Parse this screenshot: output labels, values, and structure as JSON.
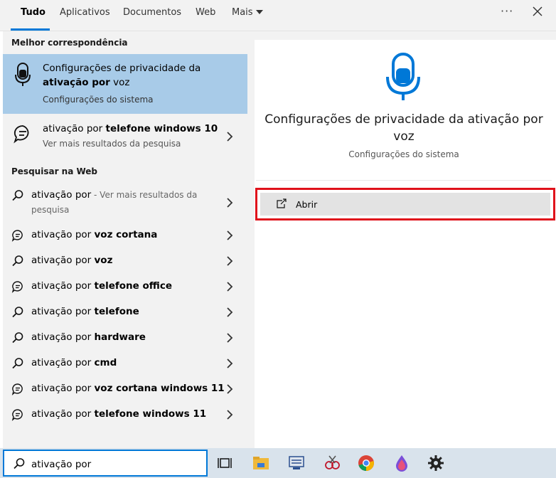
{
  "tabs": [
    {
      "label": "Tudo",
      "active": true
    },
    {
      "label": "Aplicativos"
    },
    {
      "label": "Documentos"
    },
    {
      "label": "Web"
    },
    {
      "label": "Mais"
    }
  ],
  "more_options_icon": "ellipsis-icon",
  "close_icon": "close-icon",
  "left": {
    "best_match_header": "Melhor correspondência",
    "best_match": {
      "icon": "microphone-icon",
      "line1": "Configurações de privacidade da",
      "line2_bold": "ativação por",
      "line2_rest": " voz",
      "subtitle": "Configurações do sistema"
    },
    "second_result": {
      "icon": "chat-bubble-icon",
      "prefix": "ativação por ",
      "bold": "telefone windows 10",
      "subtitle": "Ver mais resultados da pesquisa"
    },
    "web_header": "Pesquisar na Web",
    "web_first": {
      "prefix": "ativação por",
      "more": " - Ver mais resultados da",
      "more2": "pesquisa"
    },
    "web_results": [
      {
        "icon": "web-chat-icon",
        "prefix": "ativação por ",
        "bold": "voz cortana"
      },
      {
        "icon": "search-icon",
        "prefix": "ativação por ",
        "bold": "voz"
      },
      {
        "icon": "web-chat-icon",
        "prefix": "ativação por ",
        "bold": "telefone office"
      },
      {
        "icon": "search-icon",
        "prefix": "ativação por ",
        "bold": "telefone"
      },
      {
        "icon": "search-icon",
        "prefix": "ativação por ",
        "bold": "hardware"
      },
      {
        "icon": "search-icon",
        "prefix": "ativação por ",
        "bold": "cmd"
      },
      {
        "icon": "web-chat-icon",
        "prefix": "ativação por ",
        "bold": "voz cortana windows 11"
      },
      {
        "icon": "web-chat-icon",
        "prefix": "ativação por ",
        "bold": "telefone windows 11"
      }
    ]
  },
  "right": {
    "icon": "microphone-icon",
    "title_line1": "Configurações de privacidade da ativação por",
    "title_line2": "voz",
    "subtitle": "Configurações do sistema",
    "open_label": "Abrir"
  },
  "taskbar": {
    "search_value": "ativação por",
    "items": [
      "task-view-icon",
      "file-explorer-icon",
      "network-app-icon",
      "snipping-app-icon",
      "chrome-icon",
      "paint-app-icon",
      "settings-icon"
    ]
  },
  "colors": {
    "accent": "#0078d7",
    "selected_bg": "#a8cbe8",
    "highlight_border": "#e0121b"
  }
}
